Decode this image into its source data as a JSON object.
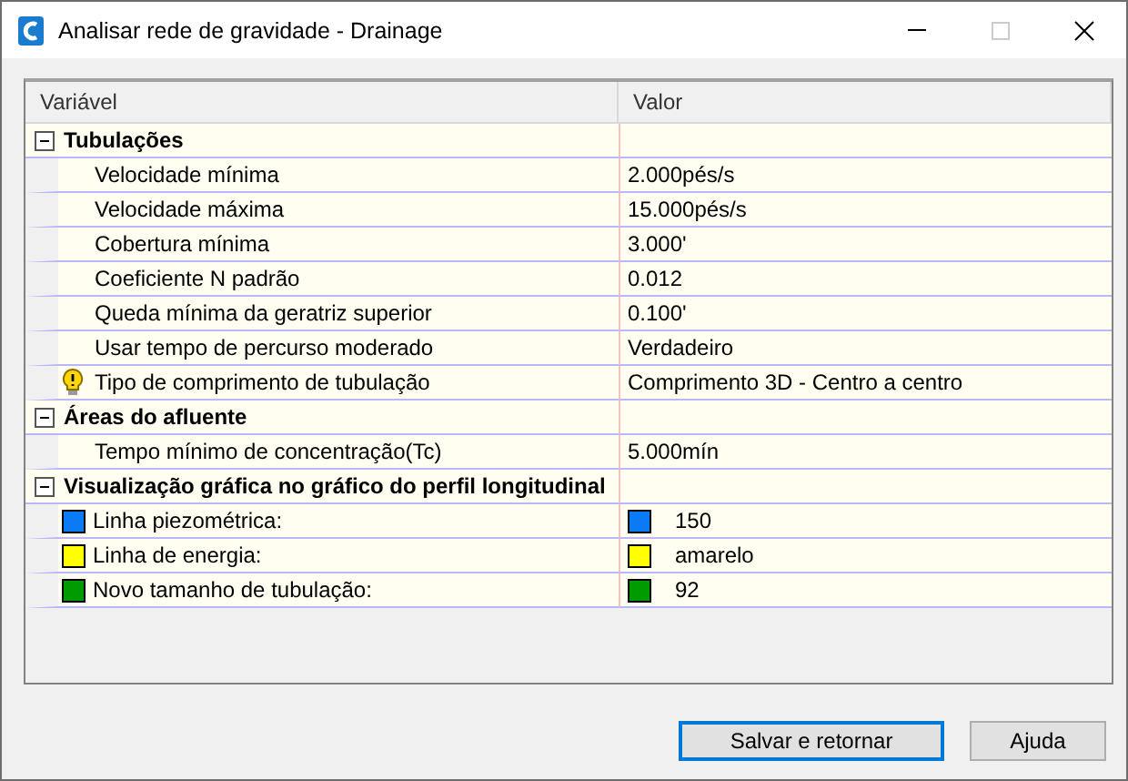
{
  "window": {
    "title": "Analisar rede de gravidade - Drainage"
  },
  "table": {
    "columns": [
      "Variável",
      "Valor"
    ],
    "groups": [
      {
        "name": "Tubulações",
        "expanded": true,
        "items": [
          {
            "name": "Velocidade mínima",
            "value": "2.000pés/s"
          },
          {
            "name": "Velocidade máxima",
            "value": "15.000pés/s"
          },
          {
            "name": "Cobertura mínima",
            "value": "3.000'"
          },
          {
            "name": "Coeficiente N padrão",
            "value": "0.012"
          },
          {
            "name": "Queda mínima da geratriz superior",
            "value": "0.100'"
          },
          {
            "name": "Usar tempo de percurso moderado",
            "value": "Verdadeiro"
          },
          {
            "name": "Tipo de comprimento de tubulação",
            "value": "Comprimento 3D - Centro a centro",
            "kind": "warning"
          }
        ]
      },
      {
        "name": "Áreas do afluente",
        "expanded": true,
        "items": [
          {
            "name": "Tempo mínimo de concentração(Tc)",
            "value": "5.000mín"
          }
        ]
      },
      {
        "name": "Visualização gráfica no gráfico do perfil longitudinal",
        "expanded": true,
        "items": [
          {
            "name": "Linha piezométrica:",
            "value": "150",
            "kind": "color",
            "color": "#0a7af5"
          },
          {
            "name": "Linha de energia:",
            "value": "amarelo",
            "kind": "color",
            "color": "#ffff00"
          },
          {
            "name": "Novo tamanho de tubulação:",
            "value": "92",
            "kind": "color",
            "color": "#009b00"
          }
        ]
      }
    ]
  },
  "buttons": [
    {
      "label": "Salvar e retornar",
      "selected": true
    },
    {
      "label": "Ajuda",
      "selected": false
    }
  ]
}
